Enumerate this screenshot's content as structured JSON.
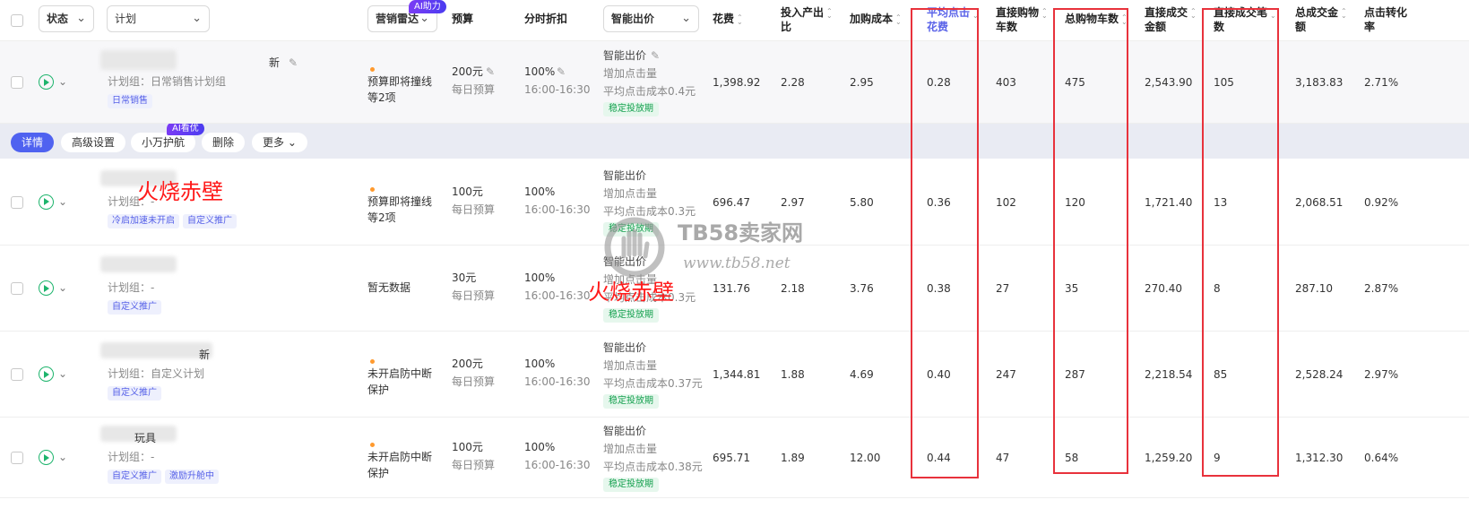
{
  "header": {
    "status_label": "状态",
    "plan_label": "计划",
    "radar_label": "营销雷达",
    "radar_badge": "AI助力",
    "columns": {
      "budget": "预算",
      "discount": "分时折扣",
      "bid": "智能出价",
      "cost": "花费",
      "roi_line1": "投入产出",
      "roi_line2": "比",
      "add_cost": "加购成本",
      "avg_click_line1": "平均点击",
      "avg_click_line2": "花费",
      "direct_cart_line1": "直接购物",
      "direct_cart_line2": "车数",
      "total_cart": "总购物车数",
      "direct_gmv_line1": "直接成交",
      "direct_gmv_line2": "金额",
      "direct_orders_line1": "直接成交笔",
      "direct_orders_line2": "数",
      "total_gmv_line1": "总成交金",
      "total_gmv_line2": "额",
      "ctr_line1": "点击转化",
      "ctr_line2": "率"
    }
  },
  "action_bar": {
    "detail": "详情",
    "advanced": "高级设置",
    "guard": "小万护航",
    "guard_badge": "AI看优",
    "delete": "删除",
    "more": "更多"
  },
  "overlays": {
    "mark1": "火烧赤壁",
    "mark2": "火烧赤壁",
    "watermark_text": "TB58卖家网",
    "watermark_url": "www.tb58.net"
  },
  "rows": [
    {
      "name_suffix": "新",
      "group": "计划组：日常销售计划组",
      "tags": [
        "日常销售"
      ],
      "radar": "预算即将撞线等2项",
      "budget": "200元",
      "budget_sub": "每日预算",
      "discount": "100%",
      "time": "16:00-16:30",
      "bid_title": "智能出价",
      "bid_l2": "增加点击量",
      "bid_l3": "平均点击成本0.4元",
      "bid_tag": "稳定投放期",
      "cost": "1,398.92",
      "roi": "2.28",
      "add_cost": "2.95",
      "avg_click": "0.28",
      "direct_cart": "403",
      "total_cart": "475",
      "direct_gmv": "2,543.90",
      "direct_orders": "105",
      "total_gmv": "3,183.83",
      "ctr": "2.71%"
    },
    {
      "name_suffix": "",
      "group": "计划组：-",
      "tags": [
        "冷启加速未开启",
        "自定义推广"
      ],
      "radar": "预算即将撞线等2项",
      "budget": "100元",
      "budget_sub": "每日预算",
      "discount": "100%",
      "time": "16:00-16:30",
      "bid_title": "智能出价",
      "bid_l2": "增加点击量",
      "bid_l3": "平均点击成本0.3元",
      "bid_tag": "稳定投放期",
      "cost": "696.47",
      "roi": "2.97",
      "add_cost": "5.80",
      "avg_click": "0.36",
      "direct_cart": "102",
      "total_cart": "120",
      "direct_gmv": "1,721.40",
      "direct_orders": "13",
      "total_gmv": "2,068.51",
      "ctr": "0.92%"
    },
    {
      "name_suffix": "",
      "group": "计划组：-",
      "tags": [
        "自定义推广"
      ],
      "radar": "暂无数据",
      "budget": "30元",
      "budget_sub": "每日预算",
      "discount": "100%",
      "time": "16:00-16:30",
      "bid_title": "智能出价",
      "bid_l2": "增加点击量",
      "bid_l3": "平均点击成本0.3元",
      "bid_tag": "稳定投放期",
      "cost": "131.76",
      "roi": "2.18",
      "add_cost": "3.76",
      "avg_click": "0.38",
      "direct_cart": "27",
      "total_cart": "35",
      "direct_gmv": "270.40",
      "direct_orders": "8",
      "total_gmv": "287.10",
      "ctr": "2.87%"
    },
    {
      "name_suffix": "新",
      "group": "计划组：自定义计划",
      "tags": [
        "自定义推广"
      ],
      "radar": "未开启防中断保护",
      "budget": "200元",
      "budget_sub": "每日预算",
      "discount": "100%",
      "time": "16:00-16:30",
      "bid_title": "智能出价",
      "bid_l2": "增加点击量",
      "bid_l3": "平均点击成本0.37元",
      "bid_tag": "稳定投放期",
      "cost": "1,344.81",
      "roi": "1.88",
      "add_cost": "4.69",
      "avg_click": "0.40",
      "direct_cart": "247",
      "total_cart": "287",
      "direct_gmv": "2,218.54",
      "direct_orders": "85",
      "total_gmv": "2,528.24",
      "ctr": "2.97%"
    },
    {
      "name_suffix": "玩具",
      "group": "计划组：-",
      "tags": [
        "自定义推广",
        "激励升舱中"
      ],
      "radar": "未开启防中断保护",
      "budget": "100元",
      "budget_sub": "每日预算",
      "discount": "100%",
      "time": "16:00-16:30",
      "bid_title": "智能出价",
      "bid_l2": "增加点击量",
      "bid_l3": "平均点击成本0.38元",
      "bid_tag": "稳定投放期",
      "cost": "695.71",
      "roi": "1.89",
      "add_cost": "12.00",
      "avg_click": "0.44",
      "direct_cart": "47",
      "total_cart": "58",
      "direct_gmv": "1,259.20",
      "direct_orders": "9",
      "total_gmv": "1,312.30",
      "ctr": "0.64%"
    }
  ]
}
